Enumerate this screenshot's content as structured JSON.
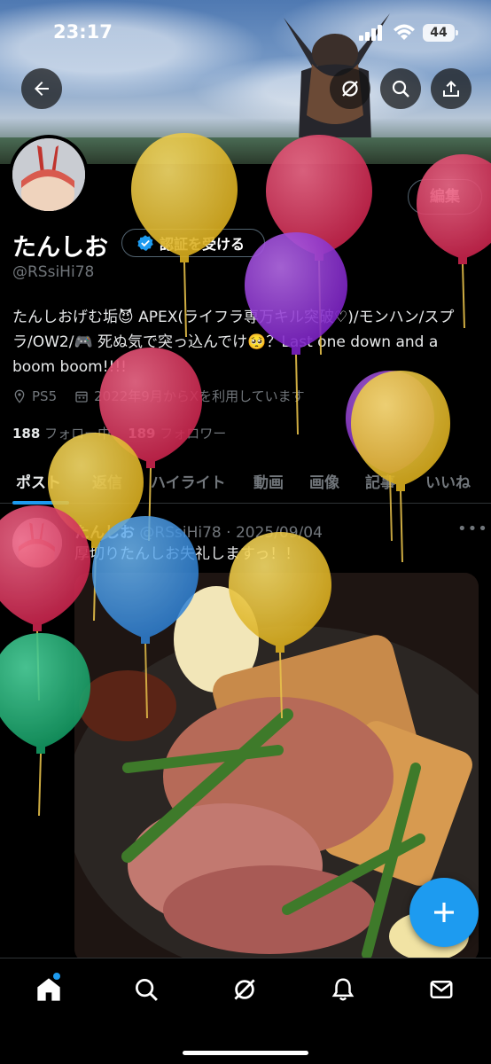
{
  "status_bar": {
    "time": "23:17",
    "battery": "44"
  },
  "profile": {
    "name": "たんしお",
    "handle": "@RSsiHi78",
    "verify_label": "認証を受ける",
    "edit_label": "編集",
    "bio": "たんしおげむ垢😈 APEX(ライフラ専万キル突破♡)/モンハン/スプラ/OW2/🎮 死ぬ気で突っ込んでけ🥺？Last one down and a boom boom!!!!",
    "location": "PS5",
    "joined": "2022年9月からXを利用しています",
    "following_count": "188",
    "following_label": "フォロー中",
    "followers_count": "189",
    "followers_label": "フォロワー"
  },
  "tabs": [
    {
      "label": "ポスト"
    },
    {
      "label": "返信"
    },
    {
      "label": "ハイライト"
    },
    {
      "label": "動画"
    },
    {
      "label": "画像"
    },
    {
      "label": "記事"
    },
    {
      "label": "いいね"
    }
  ],
  "post": {
    "author": "たんしお",
    "meta": "@RSsiHi78 · 2025/09/04",
    "text": "厚切りたんしお失礼しますっ！！",
    "more": "•••"
  },
  "icons": {
    "back": "back-arrow-icon",
    "grok": "grok-icon",
    "search": "search-icon",
    "share": "share-icon",
    "compose": "plus-icon",
    "nav": [
      "home-icon",
      "search-icon",
      "grok-icon",
      "bell-icon",
      "mail-icon"
    ]
  },
  "colors": {
    "accent": "#1d9bf0",
    "background": "#000000",
    "secondary_text": "#71767b",
    "border": "#2f3336"
  }
}
